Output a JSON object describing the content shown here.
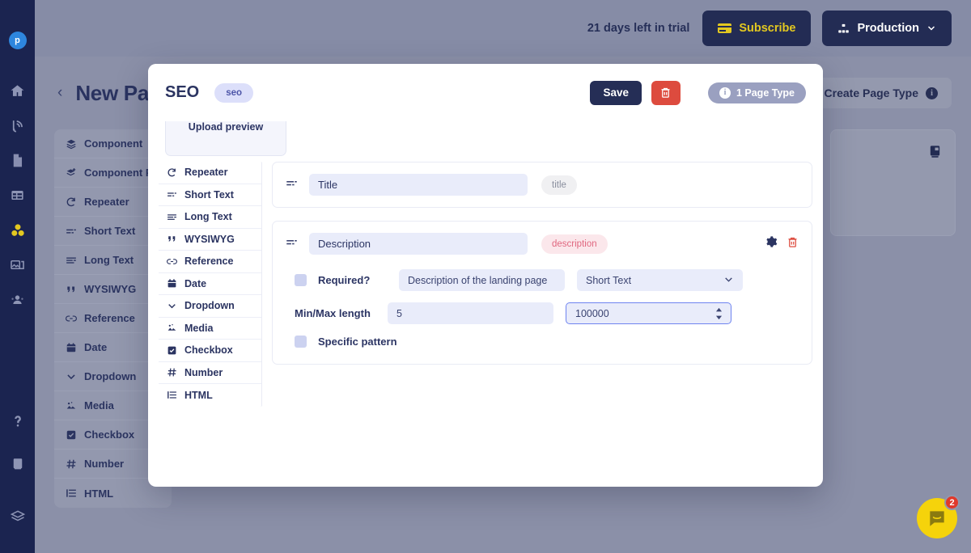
{
  "rail": {
    "avatar_label": "p",
    "items": [
      {
        "name": "home-icon"
      },
      {
        "name": "broadcast-icon"
      },
      {
        "name": "document-icon"
      },
      {
        "name": "table-icon"
      },
      {
        "name": "components-icon",
        "active": true
      },
      {
        "name": "media-icon"
      },
      {
        "name": "users-icon"
      }
    ],
    "bottom_items": [
      {
        "name": "help-icon"
      },
      {
        "name": "book-icon"
      },
      {
        "name": "layers-icon"
      }
    ]
  },
  "topbar": {
    "trial_text": "21 days left in trial",
    "subscribe_label": "Subscribe",
    "environment_label": "Production"
  },
  "page_header": {
    "title": "New Page",
    "create_page_type_label": "Create Page Type"
  },
  "background_sidebar": {
    "items": [
      {
        "label": "Component",
        "icon": "layers-icon"
      },
      {
        "label": "Component Picker",
        "icon": "layers-plus-icon"
      },
      {
        "label": "Repeater",
        "icon": "repeat-icon"
      },
      {
        "label": "Short Text",
        "icon": "short-text-icon"
      },
      {
        "label": "Long Text",
        "icon": "long-text-icon"
      },
      {
        "label": "WYSIWYG",
        "icon": "quote-icon"
      },
      {
        "label": "Reference",
        "icon": "link-icon"
      },
      {
        "label": "Date",
        "icon": "calendar-icon"
      },
      {
        "label": "Dropdown",
        "icon": "chevron-down-icon"
      },
      {
        "label": "Media",
        "icon": "image-icon"
      },
      {
        "label": "Checkbox",
        "icon": "checkbox-icon"
      },
      {
        "label": "Number",
        "icon": "hash-icon"
      },
      {
        "label": "HTML",
        "icon": "list-icon"
      }
    ]
  },
  "modal": {
    "title": "SEO",
    "key_badge": "seo",
    "save_label": "Save",
    "page_type_badge": "1 Page Type",
    "upload_preview_label": "Upload preview",
    "palette": [
      {
        "label": "Repeater",
        "icon": "repeat-icon"
      },
      {
        "label": "Short Text",
        "icon": "short-text-icon"
      },
      {
        "label": "Long Text",
        "icon": "long-text-icon"
      },
      {
        "label": "WYSIWYG",
        "icon": "quote-icon"
      },
      {
        "label": "Reference",
        "icon": "link-icon"
      },
      {
        "label": "Date",
        "icon": "calendar-icon"
      },
      {
        "label": "Dropdown",
        "icon": "chevron-down-icon"
      },
      {
        "label": "Media",
        "icon": "image-icon"
      },
      {
        "label": "Checkbox",
        "icon": "checkbox-icon"
      },
      {
        "label": "Number",
        "icon": "hash-icon"
      },
      {
        "label": "HTML",
        "icon": "list-icon"
      }
    ],
    "fields": [
      {
        "name_value": "Title",
        "key": "title"
      },
      {
        "name_value": "Description",
        "key": "description"
      }
    ],
    "settings": {
      "required_label": "Required?",
      "placeholder_value": "Description of the landing page",
      "type_value": "Short Text",
      "minmax_label": "Min/Max length",
      "min_value": "5",
      "max_value": "100000",
      "specific_pattern_label": "Specific pattern"
    }
  },
  "intercom": {
    "unread_count": "2"
  },
  "colors": {
    "accent_dark": "#252e56",
    "danger": "#dd4b3e",
    "trial_yellow": "#e3c820",
    "input_bg": "#e9ecfa",
    "focus_border": "#6f84f0"
  }
}
